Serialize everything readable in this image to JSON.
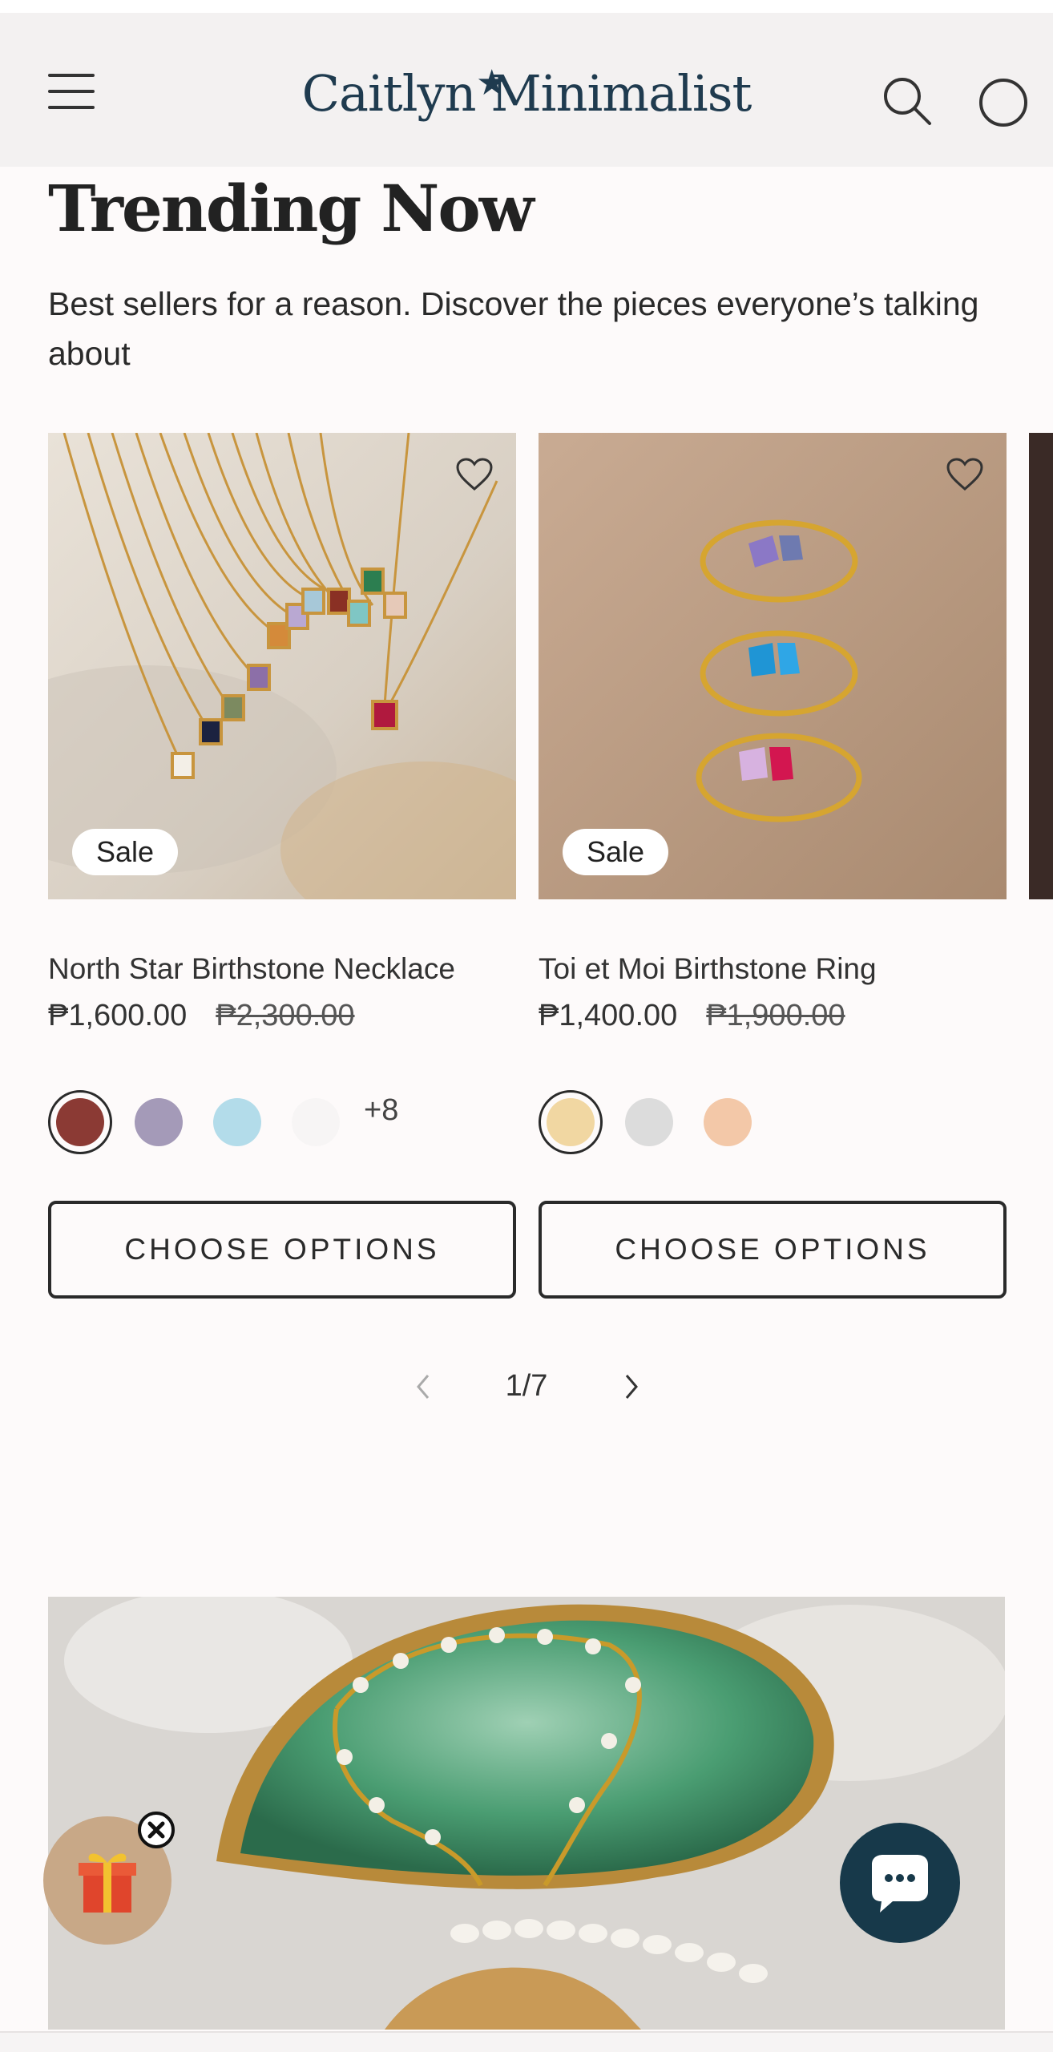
{
  "header": {
    "logo": "Caitlyn Minimalist",
    "menu_icon": "hamburger-menu-icon",
    "search_icon": "search-icon",
    "account_icon": "account-circle-icon"
  },
  "section": {
    "title": "Trending Now",
    "subtitle": "Best sellers for a reason. Discover the pieces everyone’s talking about"
  },
  "products": [
    {
      "name": "North Star Birthstone Necklace",
      "price": "₱1,600.00",
      "compare_price": "₱2,300.00",
      "badge": "Sale",
      "swatches": [
        "#8b3a34",
        "#a49ab8",
        "#b3dcea",
        "#f7f5f5"
      ],
      "more_swatches": "+8",
      "button": "CHOOSE OPTIONS"
    },
    {
      "name": "Toi et Moi Birthstone Ring",
      "price": "₱1,400.00",
      "compare_price": "₱1,900.00",
      "badge": "Sale",
      "swatches": [
        "#f1d7a2",
        "#dcdcdc",
        "#f3c8a8"
      ],
      "button": "CHOOSE OPTIONS"
    }
  ],
  "pager": {
    "current": "1/7"
  },
  "colors": {
    "accent": "#1f3b4f",
    "chat": "#17394a",
    "gift": "#c8a887"
  }
}
